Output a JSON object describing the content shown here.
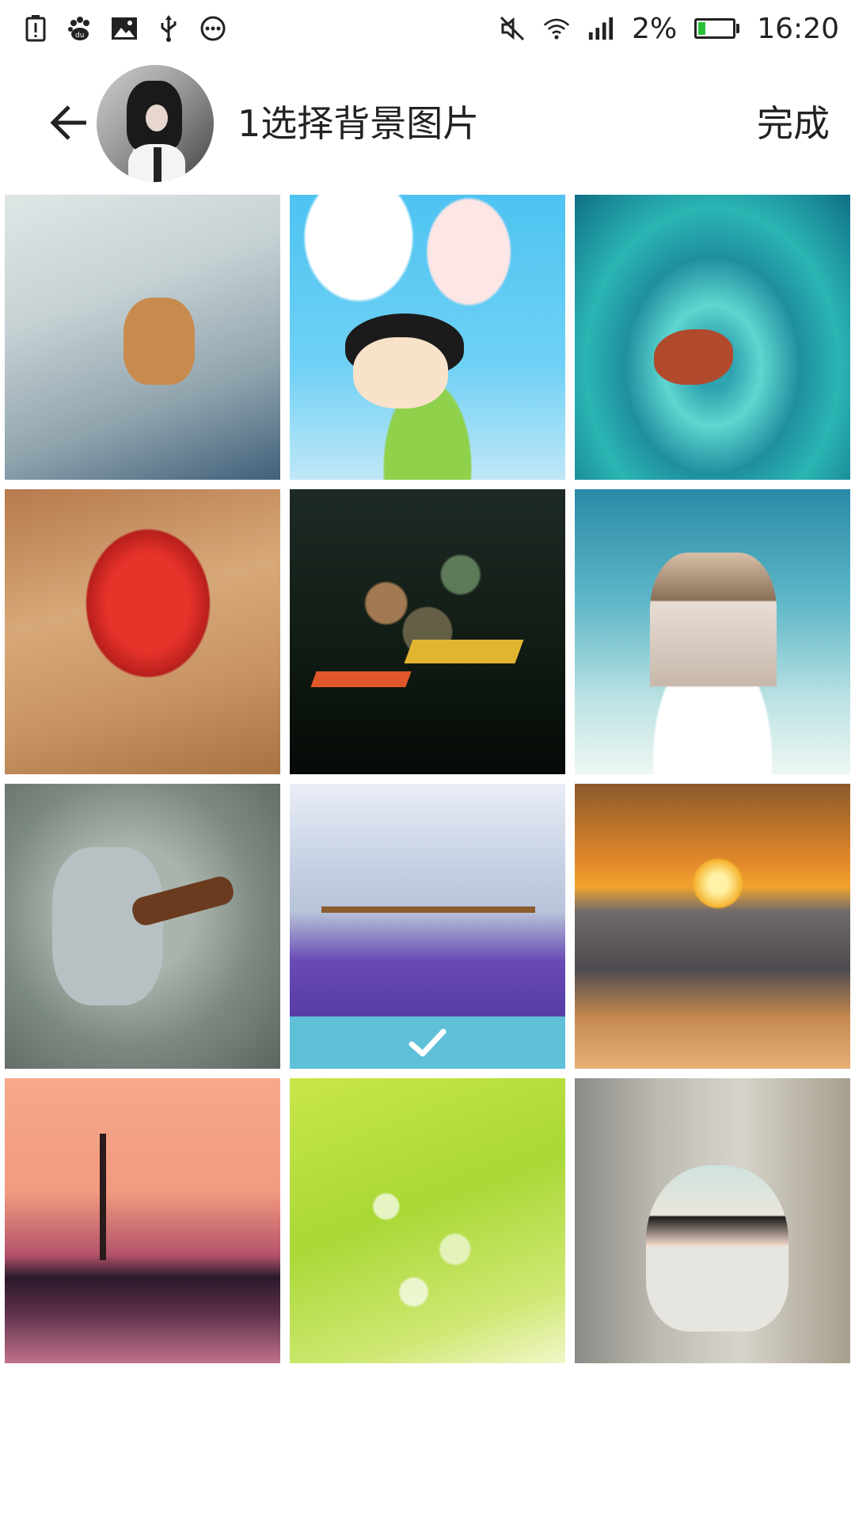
{
  "status_bar": {
    "left_icons": [
      "battery-alert-icon",
      "baidu-icon",
      "image-icon",
      "usb-icon",
      "more-icon"
    ],
    "right_icons": [
      "mute-icon",
      "wifi-icon",
      "signal-icon"
    ],
    "battery_percent": "2%",
    "battery_level": 0.02,
    "battery_color": "#27c23a",
    "time": "16:20"
  },
  "header": {
    "back_icon": "arrow-left-icon",
    "title": "1选择背景图片",
    "done_label": "完成"
  },
  "grid": {
    "selected_index": 7,
    "check_color": "#5fc0d8",
    "tiles": [
      {
        "name": "tile-teddy-bear-bench"
      },
      {
        "name": "tile-cartoon-girl"
      },
      {
        "name": "tile-leaf-water"
      },
      {
        "name": "tile-strawberry"
      },
      {
        "name": "tile-paper-cranes"
      },
      {
        "name": "tile-cartoon-couple"
      },
      {
        "name": "tile-robot-cartoon"
      },
      {
        "name": "tile-lavender-field"
      },
      {
        "name": "tile-sunset-beach"
      },
      {
        "name": "tile-tree-reflection"
      },
      {
        "name": "tile-green-bokeh"
      },
      {
        "name": "tile-doll"
      }
    ]
  }
}
